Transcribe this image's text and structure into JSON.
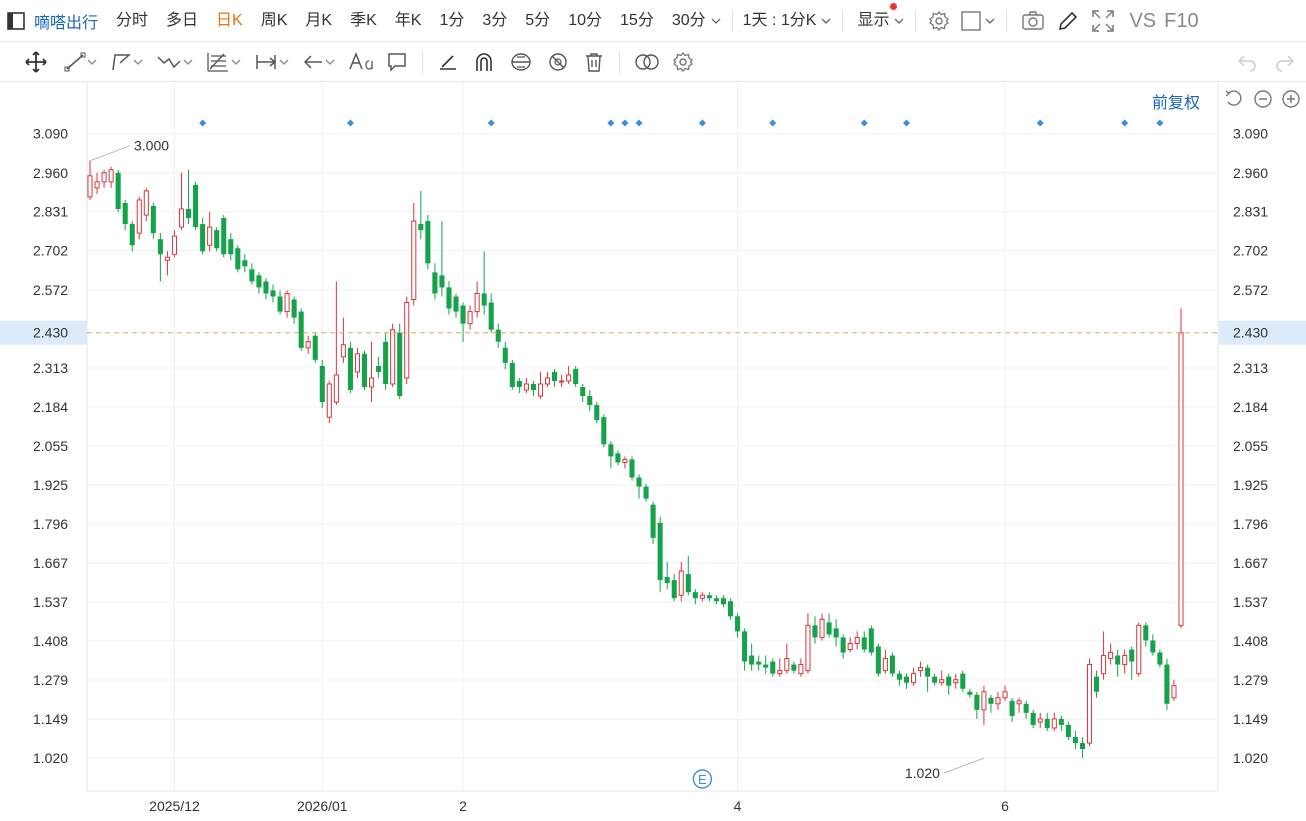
{
  "toolbar": {
    "title": "嘀嗒出行",
    "period_tabs": [
      "分时",
      "多日",
      "日K",
      "周K",
      "月K",
      "季K",
      "年K",
      "1分",
      "3分",
      "5分",
      "10分",
      "15分",
      "30分"
    ],
    "active_tab": "日K",
    "multi_label": "1天 : 1分K",
    "display_label": "显示",
    "vs_label": "VS",
    "f10_label": "F10"
  },
  "chart_header": {
    "adjust_label": "前复权"
  },
  "colors": {
    "up": "#d9363e",
    "down": "#14a34a",
    "accent": "#1766c2",
    "active_tab": "#e8730c"
  },
  "chart_data": {
    "type": "candlestick",
    "y_ticks": [
      "3.090",
      "2.960",
      "2.831",
      "2.702",
      "2.572",
      "2.430",
      "2.313",
      "2.184",
      "2.055",
      "1.925",
      "1.796",
      "1.667",
      "1.537",
      "1.408",
      "1.279",
      "1.149",
      "1.020"
    ],
    "ylim": [
      0.911,
      3.188
    ],
    "current_price": "2.430",
    "x_labels": [
      {
        "label": "2025/12",
        "index": 12
      },
      {
        "label": "2026/01",
        "index": 33
      },
      {
        "label": "2",
        "index": 53
      },
      {
        "label": "4",
        "index": 92
      },
      {
        "label": "6",
        "index": 130
      }
    ],
    "annotations": [
      {
        "label": "3.000",
        "index": 0,
        "value": 3.0
      },
      {
        "label": "1.020",
        "index": 127,
        "value": 1.02
      }
    ],
    "event_marker_indices": [
      16,
      37,
      57,
      74,
      76,
      78,
      87,
      97,
      110,
      116,
      135,
      147,
      152
    ],
    "earnings_marker": {
      "label": "E",
      "index": 87
    },
    "candles": [
      [
        2.88,
        2.95,
        3.0,
        2.87
      ],
      [
        2.91,
        2.93,
        2.96,
        2.89
      ],
      [
        2.93,
        2.96,
        2.97,
        2.91
      ],
      [
        2.93,
        2.97,
        2.98,
        2.91
      ],
      [
        2.96,
        2.84,
        2.97,
        2.83
      ],
      [
        2.86,
        2.79,
        2.87,
        2.77
      ],
      [
        2.79,
        2.72,
        2.8,
        2.7
      ],
      [
        2.76,
        2.87,
        2.88,
        2.74
      ],
      [
        2.82,
        2.9,
        2.91,
        2.8
      ],
      [
        2.85,
        2.76,
        2.86,
        2.74
      ],
      [
        2.74,
        2.69,
        2.76,
        2.6
      ],
      [
        2.67,
        2.68,
        2.7,
        2.62
      ],
      [
        2.69,
        2.75,
        2.77,
        2.68
      ],
      [
        2.78,
        2.84,
        2.96,
        2.77
      ],
      [
        2.84,
        2.81,
        2.97,
        2.79
      ],
      [
        2.92,
        2.78,
        2.93,
        2.77
      ],
      [
        2.79,
        2.7,
        2.81,
        2.69
      ],
      [
        2.72,
        2.78,
        2.83,
        2.7
      ],
      [
        2.77,
        2.71,
        2.78,
        2.7
      ],
      [
        2.81,
        2.69,
        2.82,
        2.68
      ],
      [
        2.74,
        2.69,
        2.76,
        2.67
      ],
      [
        2.71,
        2.64,
        2.72,
        2.63
      ],
      [
        2.67,
        2.65,
        2.69,
        2.63
      ],
      [
        2.64,
        2.6,
        2.66,
        2.59
      ],
      [
        2.62,
        2.58,
        2.63,
        2.56
      ],
      [
        2.6,
        2.56,
        2.61,
        2.54
      ],
      [
        2.57,
        2.55,
        2.59,
        2.53
      ],
      [
        2.55,
        2.5,
        2.57,
        2.49
      ],
      [
        2.5,
        2.56,
        2.57,
        2.48
      ],
      [
        2.54,
        2.48,
        2.55,
        2.46
      ],
      [
        2.5,
        2.38,
        2.51,
        2.37
      ],
      [
        2.38,
        2.4,
        2.42,
        2.36
      ],
      [
        2.42,
        2.34,
        2.43,
        2.33
      ],
      [
        2.32,
        2.2,
        2.34,
        2.18
      ],
      [
        2.15,
        2.26,
        2.27,
        2.13
      ],
      [
        2.2,
        2.29,
        2.6,
        2.19
      ],
      [
        2.35,
        2.39,
        2.48,
        2.33
      ],
      [
        2.38,
        2.24,
        2.4,
        2.23
      ],
      [
        2.3,
        2.36,
        2.38,
        2.28
      ],
      [
        2.36,
        2.25,
        2.37,
        2.24
      ],
      [
        2.25,
        2.28,
        2.4,
        2.2
      ],
      [
        2.32,
        2.3,
        2.35,
        2.28
      ],
      [
        2.4,
        2.26,
        2.43,
        2.24
      ],
      [
        2.26,
        2.44,
        2.46,
        2.25
      ],
      [
        2.43,
        2.22,
        2.46,
        2.21
      ],
      [
        2.28,
        2.53,
        2.55,
        2.26
      ],
      [
        2.54,
        2.8,
        2.86,
        2.52
      ],
      [
        2.79,
        2.77,
        2.9,
        2.74
      ],
      [
        2.8,
        2.66,
        2.82,
        2.64
      ],
      [
        2.63,
        2.56,
        2.66,
        2.54
      ]
    ],
    "candles_b": [
      [
        2.62,
        2.58,
        2.8,
        2.55
      ],
      [
        2.58,
        2.51,
        2.6,
        2.49
      ],
      [
        2.55,
        2.5,
        2.56,
        2.48
      ],
      [
        2.52,
        2.46,
        2.53,
        2.4
      ],
      [
        2.46,
        2.5,
        2.52,
        2.44
      ],
      [
        2.5,
        2.56,
        2.6,
        2.48
      ],
      [
        2.56,
        2.52,
        2.7,
        2.49
      ],
      [
        2.53,
        2.44,
        2.56,
        2.43
      ],
      [
        2.44,
        2.4,
        2.46,
        2.38
      ],
      [
        2.38,
        2.33,
        2.4,
        2.31
      ],
      [
        2.33,
        2.25,
        2.34,
        2.24
      ],
      [
        2.27,
        2.25,
        2.28,
        2.23
      ],
      [
        2.24,
        2.26,
        2.28,
        2.23
      ],
      [
        2.26,
        2.24,
        2.27,
        2.22
      ],
      [
        2.22,
        2.26,
        2.3,
        2.21
      ],
      [
        2.26,
        2.28,
        2.3,
        2.25
      ],
      [
        2.3,
        2.27,
        2.31,
        2.25
      ],
      [
        2.27,
        2.27,
        2.29,
        2.25
      ],
      [
        2.27,
        2.29,
        2.32,
        2.26
      ],
      [
        2.31,
        2.26,
        2.32,
        2.25
      ],
      [
        2.25,
        2.22,
        2.26,
        2.2
      ],
      [
        2.22,
        2.19,
        2.24,
        2.17
      ],
      [
        2.19,
        2.14,
        2.2,
        2.13
      ],
      [
        2.15,
        2.06,
        2.16,
        2.05
      ],
      [
        2.06,
        2.02,
        2.07,
        1.98
      ],
      [
        2.03,
        2.0,
        2.04,
        1.99
      ],
      [
        2.0,
        2.01,
        2.02,
        1.98
      ],
      [
        2.01,
        1.95,
        2.02,
        1.94
      ],
      [
        1.95,
        1.92,
        1.96,
        1.88
      ],
      [
        1.92,
        1.88,
        1.93,
        1.87
      ],
      [
        1.86,
        1.75,
        1.87,
        1.73
      ],
      [
        1.8,
        1.61,
        1.82,
        1.57
      ],
      [
        1.62,
        1.6,
        1.67,
        1.58
      ],
      [
        1.61,
        1.55,
        1.63,
        1.54
      ],
      [
        1.56,
        1.64,
        1.67,
        1.54
      ],
      [
        1.63,
        1.57,
        1.69,
        1.56
      ],
      [
        1.57,
        1.55,
        1.58,
        1.53
      ],
      [
        1.55,
        1.56,
        1.57,
        1.54
      ],
      [
        1.56,
        1.55,
        1.57,
        1.54
      ],
      [
        1.55,
        1.54,
        1.56,
        1.53
      ],
      [
        1.55,
        1.53,
        1.56,
        1.52
      ]
    ],
    "candles_c": [
      [
        1.54,
        1.49,
        1.55,
        1.48
      ],
      [
        1.49,
        1.44,
        1.5,
        1.42
      ],
      [
        1.44,
        1.34,
        1.45,
        1.31
      ],
      [
        1.36,
        1.33,
        1.4,
        1.31
      ],
      [
        1.34,
        1.33,
        1.36,
        1.31
      ],
      [
        1.33,
        1.32,
        1.36,
        1.3
      ],
      [
        1.34,
        1.3,
        1.35,
        1.29
      ],
      [
        1.3,
        1.31,
        1.35,
        1.29
      ],
      [
        1.31,
        1.35,
        1.4,
        1.3
      ],
      [
        1.33,
        1.31,
        1.34,
        1.3
      ],
      [
        1.3,
        1.33,
        1.35,
        1.29
      ],
      [
        1.31,
        1.46,
        1.5,
        1.3
      ],
      [
        1.46,
        1.42,
        1.49,
        1.4
      ],
      [
        1.42,
        1.48,
        1.5,
        1.41
      ],
      [
        1.47,
        1.43,
        1.5,
        1.42
      ],
      [
        1.45,
        1.42,
        1.48,
        1.39
      ],
      [
        1.42,
        1.37,
        1.43,
        1.35
      ],
      [
        1.38,
        1.4,
        1.42,
        1.37
      ],
      [
        1.4,
        1.42,
        1.44,
        1.38
      ],
      [
        1.42,
        1.38,
        1.44,
        1.37
      ],
      [
        1.45,
        1.37,
        1.46,
        1.36
      ],
      [
        1.39,
        1.3,
        1.4,
        1.29
      ],
      [
        1.31,
        1.35,
        1.38,
        1.3
      ],
      [
        1.36,
        1.3,
        1.37,
        1.29
      ],
      [
        1.3,
        1.28,
        1.31,
        1.26
      ],
      [
        1.29,
        1.27,
        1.3,
        1.25
      ],
      [
        1.27,
        1.3,
        1.32,
        1.26
      ],
      [
        1.31,
        1.32,
        1.34,
        1.29
      ],
      [
        1.32,
        1.29,
        1.33,
        1.24
      ],
      [
        1.29,
        1.27,
        1.3,
        1.26
      ],
      [
        1.27,
        1.28,
        1.31,
        1.26
      ],
      [
        1.29,
        1.26,
        1.3,
        1.23
      ],
      [
        1.27,
        1.28,
        1.3,
        1.25
      ],
      [
        1.3,
        1.25,
        1.31,
        1.24
      ],
      [
        1.24,
        1.23,
        1.25,
        1.22
      ],
      [
        1.23,
        1.18,
        1.24,
        1.15
      ],
      [
        1.18,
        1.24,
        1.26,
        1.13
      ],
      [
        1.22,
        1.2,
        1.23,
        1.17
      ],
      [
        1.2,
        1.22,
        1.24,
        1.18
      ],
      [
        1.22,
        1.24,
        1.26,
        1.21
      ],
      [
        1.21,
        1.16,
        1.22,
        1.14
      ],
      [
        1.2,
        1.21,
        1.22,
        1.17
      ],
      [
        1.2,
        1.17,
        1.21,
        1.15
      ],
      [
        1.17,
        1.13,
        1.18,
        1.12
      ],
      [
        1.14,
        1.15,
        1.17,
        1.12
      ],
      [
        1.15,
        1.12,
        1.17,
        1.11
      ],
      [
        1.12,
        1.15,
        1.17,
        1.11
      ],
      [
        1.15,
        1.13,
        1.16,
        1.11
      ],
      [
        1.13,
        1.09,
        1.14,
        1.08
      ],
      [
        1.09,
        1.07,
        1.11,
        1.05
      ],
      [
        1.07,
        1.05,
        1.09,
        1.02
      ]
    ],
    "candles_d": [
      [
        1.07,
        1.33,
        1.35,
        1.06
      ],
      [
        1.29,
        1.24,
        1.31,
        1.22
      ],
      [
        1.3,
        1.36,
        1.44,
        1.28
      ],
      [
        1.35,
        1.37,
        1.4,
        1.33
      ],
      [
        1.36,
        1.33,
        1.38,
        1.29
      ],
      [
        1.33,
        1.36,
        1.38,
        1.3
      ],
      [
        1.38,
        1.34,
        1.39,
        1.28
      ],
      [
        1.3,
        1.46,
        1.47,
        1.29
      ],
      [
        1.46,
        1.41,
        1.47,
        1.39
      ],
      [
        1.41,
        1.37,
        1.43,
        1.36
      ],
      [
        1.37,
        1.33,
        1.38,
        1.32
      ],
      [
        1.33,
        1.2,
        1.35,
        1.18
      ],
      [
        1.22,
        1.26,
        1.28,
        1.21
      ],
      [
        1.46,
        2.43,
        2.51,
        1.45
      ]
    ]
  }
}
